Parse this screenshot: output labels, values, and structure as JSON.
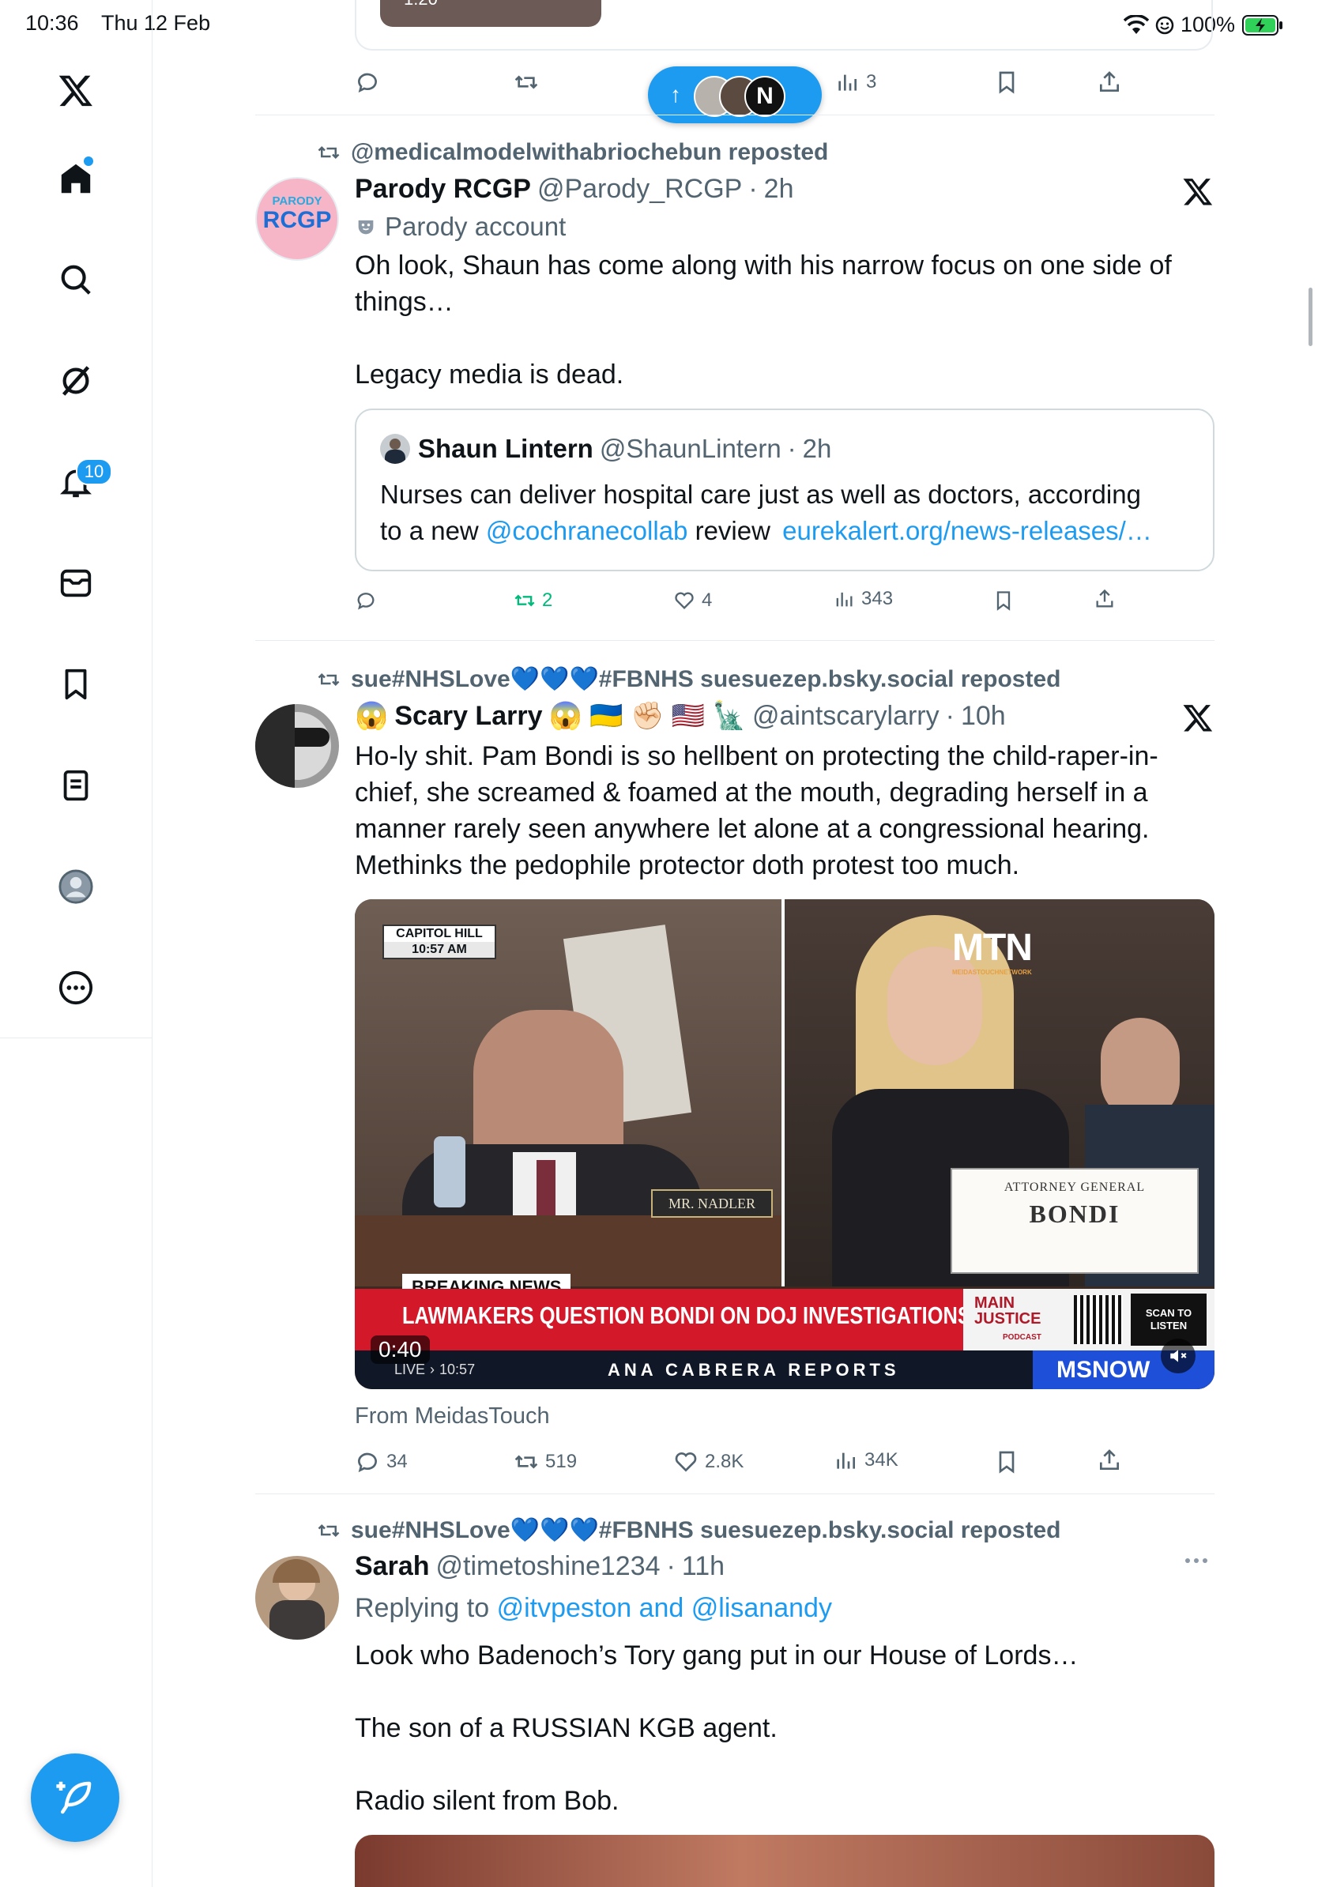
{
  "status_bar": {
    "time": "10:36",
    "date": "Thu 12 Feb",
    "battery": "100%"
  },
  "sidebar": {
    "notifications_badge": "10"
  },
  "top_post": {
    "video_time": "1:20",
    "views": "3"
  },
  "pill": {
    "arrow": "↑",
    "avatar3": "N"
  },
  "posts": [
    {
      "reposter": "@medicalmodelwithabriochebun reposted",
      "name": "Parody RCGP",
      "handle": "@Parody_RCGP",
      "time": "2h",
      "avatar_label_top": "PARODY",
      "avatar_label": "RCGP",
      "parody_label": "Parody account",
      "text_lines": [
        "Oh look, Shaun has come along with his narrow focus on one side of",
        "things…"
      ],
      "text_line2": "Legacy media is dead.",
      "quote": {
        "name": "Shaun Lintern",
        "handle": "@ShaunLintern",
        "time": "2h",
        "text1": "Nurses can deliver hospital care just as well as doctors, according",
        "text2_pre": "to a new",
        "mention": "@cochranecollab",
        "text2_mid": "review",
        "url": "eurekalert.org/news-releases/…"
      },
      "replies": "",
      "reposts": "2",
      "likes": "4",
      "views": "343"
    },
    {
      "reposter": "sue#NHSLove💙💙💙#FBNHS suesuezep.bsky.social reposted",
      "name_prefix": "😱",
      "name": "Scary Larry",
      "name_suffix": "😱 🇺🇦 ✊🏻 🇺🇸 🗽",
      "handle": "@aintscarylarry",
      "time": "10h",
      "text_lines": [
        "Ho-ly shit. Pam Bondi is so hellbent on protecting the child-raper-in-",
        "chief, she screamed & foamed at the mouth, degrading herself in a",
        "manner rarely seen anywhere let alone at a congressional hearing.",
        "Methinks the pedophile protector doth protest too much."
      ],
      "video": {
        "capitol": "CAPITOL HILL",
        "capitol_time": "10:57 AM",
        "mtn": "MTN",
        "mtn_sub": "MEIDASTOUCHNETWORK",
        "nameplate_left": "MR. NADLER",
        "nameplate_title": "ATTORNEY GENERAL",
        "nameplate_name": "BONDI",
        "breaking": "BREAKING NEWS",
        "headline": "LAWMAKERS QUESTION BONDI ON DOJ INVESTIGATIONS OF DEMS",
        "main_justice": "MAIN JUSTICE",
        "podcast": "PODCAST",
        "scan": "SCAN TO LISTEN",
        "live": "LIVE",
        "live_time": "10:57",
        "reports": "ANA CABRERA REPORTS",
        "network": "MSNOW",
        "duration": "0:40"
      },
      "source": "From MeidasTouch",
      "replies": "34",
      "reposts": "519",
      "likes": "2.8K",
      "views": "34K"
    },
    {
      "reposter": "sue#NHSLove💙💙💙#FBNHS suesuezep.bsky.social reposted",
      "name": "Sarah",
      "handle": "@timetoshine1234",
      "time": "11h",
      "replying_prefix": "Replying to",
      "replying_to": "@itvpeston and @lisanandy",
      "text_line1": "Look who Badenoch’s Tory gang put in our House of Lords…",
      "text_line2": "The son of a RUSSIAN KGB agent.",
      "text_line3": "Radio silent from Bob."
    }
  ]
}
